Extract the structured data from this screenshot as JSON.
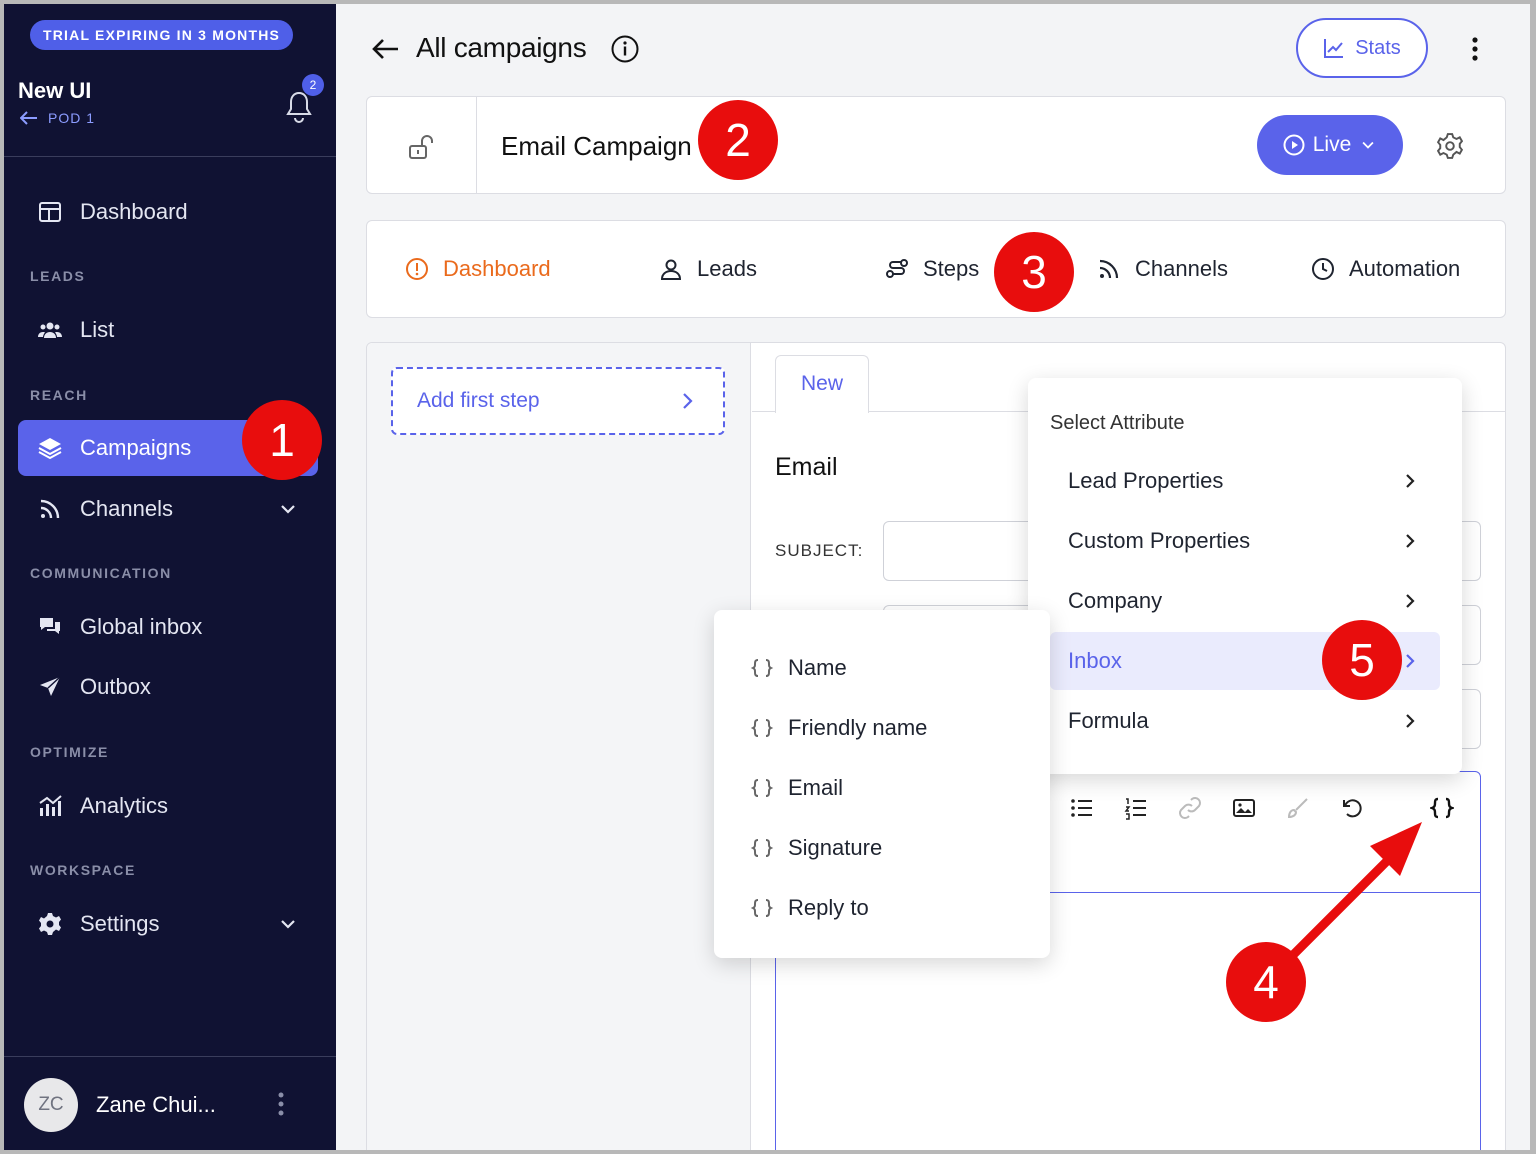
{
  "sidebar": {
    "trial_badge": "TRIAL EXPIRING IN 3 MONTHS",
    "workspace_name": "New UI",
    "workspace_sub": "POD 1",
    "notifications_count": "2",
    "items": {
      "dashboard": "Dashboard",
      "list": "List",
      "campaigns": "Campaigns",
      "channels": "Channels",
      "global_inbox": "Global inbox",
      "outbox": "Outbox",
      "analytics": "Analytics",
      "settings": "Settings"
    },
    "sections": {
      "leads": "LEADS",
      "reach": "REACH",
      "communication": "COMMUNICATION",
      "optimize": "OPTIMIZE",
      "workspace": "WORKSPACE"
    },
    "user": {
      "initials": "ZC",
      "name": "Zane Chui..."
    }
  },
  "header": {
    "title": "All campaigns",
    "stats_label": "Stats"
  },
  "campaign": {
    "name": "Email Campaign",
    "status_label": "Live"
  },
  "tabs": {
    "dashboard": "Dashboard",
    "leads": "Leads",
    "steps": "Steps",
    "channels": "Channels",
    "automation": "Automation"
  },
  "steps": {
    "add_first_step": "Add first step"
  },
  "editor": {
    "tab_label": "New",
    "heading": "Email",
    "subject_label": "SUBJECT:"
  },
  "attribute_menu": {
    "title": "Select Attribute",
    "items": [
      "Lead Properties",
      "Custom Properties",
      "Company",
      "Inbox",
      "Formula"
    ],
    "hovered": "Inbox"
  },
  "inbox_submenu": {
    "items": [
      "Name",
      "Friendly name",
      "Email",
      "Signature",
      "Reply to"
    ]
  },
  "annotations": [
    "1",
    "2",
    "3",
    "4",
    "5"
  ],
  "colors": {
    "sidebar_bg": "#101233",
    "accent": "#5a63ea",
    "active_tab": "#ea6a1c",
    "annotation_red": "#e80d0d"
  },
  "icons": {
    "sidebar": [
      "dashboard-icon",
      "users-icon",
      "layers-icon",
      "rss-icon",
      "chat-icon",
      "send-icon",
      "analytics-icon",
      "gear-icon"
    ],
    "tabs": [
      "info-icon",
      "user-icon",
      "route-icon",
      "rss-icon",
      "clock-icon"
    ],
    "editor_toolbar": [
      "bullet-list-icon",
      "numbered-list-icon",
      "link-icon",
      "image-icon",
      "brush-icon",
      "undo-icon",
      "variable-braces-icon"
    ]
  }
}
